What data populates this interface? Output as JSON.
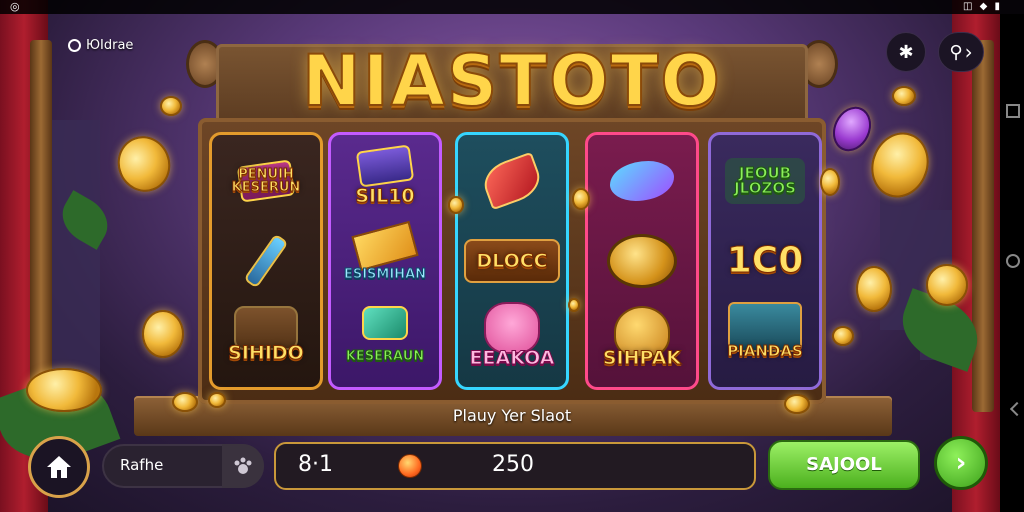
{
  "status_bar": {
    "left_icon": "signal-icon",
    "right_icons": "◫ ◆ ▮"
  },
  "header": {
    "brand_label": "ЮIdrae",
    "settings_icon": "gear-icon",
    "search_icon": "search-icon",
    "search_arrow": "›"
  },
  "logo": {
    "title": "NIASTOTO"
  },
  "reels": [
    {
      "symbols": [
        {
          "text": "PENUIH\nKESERUN",
          "icon": "treasure-chest-icon"
        },
        {
          "text": "",
          "icon": "chisel-icon"
        },
        {
          "text": "SIHIDO",
          "icon": "barrel-icon"
        }
      ]
    },
    {
      "symbols": [
        {
          "text": "SIL10",
          "icon": "ticket-icon"
        },
        {
          "text": "ESISMIHAN",
          "icon": "cheese-icon"
        },
        {
          "text": "KESERAUN",
          "icon": "gem-icon"
        }
      ]
    },
    {
      "symbols": [
        {
          "text": "",
          "icon": "horn-icon"
        },
        {
          "text": "DLOCC",
          "icon": "plaque-icon"
        },
        {
          "text": "EEAKOA",
          "icon": "cat-icon"
        }
      ]
    },
    {
      "symbols": [
        {
          "text": "",
          "icon": "fish-icon"
        },
        {
          "text": "",
          "icon": "coin-icon"
        },
        {
          "text": "SIHPAK",
          "icon": "bell-icon"
        }
      ]
    },
    {
      "symbols": [
        {
          "text": "JEOUB\nJLOZOS",
          "icon": "banner-icon"
        },
        {
          "text": "1C0",
          "icon": ""
        },
        {
          "text": "PIANDAS",
          "icon": "crate-icon"
        }
      ]
    }
  ],
  "caption": "Plauy Yer Slaot",
  "bottom_bar": {
    "home_icon": "home-icon",
    "pill_label": "Rafhe",
    "pill_icon": "paw-icon",
    "balance_left": "8·1",
    "balance_right": "250",
    "spin_label": "SAJOOL",
    "go_arrow": "›"
  }
}
